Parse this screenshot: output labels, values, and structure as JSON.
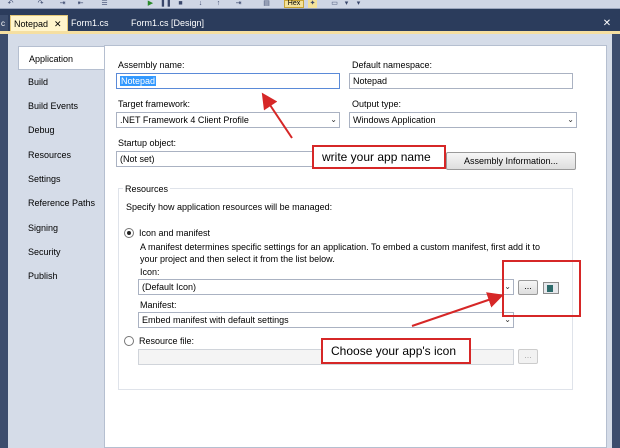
{
  "toolbar": {
    "hex_label": "Hex"
  },
  "tabs": [
    {
      "label": "Notepad",
      "close": "✕",
      "active": true
    },
    {
      "label": "Form1.cs",
      "active": false
    },
    {
      "label": "Form1.cs [Design]",
      "active": false
    }
  ],
  "window_close": "✕",
  "sidebar": {
    "items": [
      {
        "label": "Application"
      },
      {
        "label": "Build"
      },
      {
        "label": "Build Events"
      },
      {
        "label": "Debug"
      },
      {
        "label": "Resources"
      },
      {
        "label": "Settings"
      },
      {
        "label": "Reference Paths"
      },
      {
        "label": "Signing"
      },
      {
        "label": "Security"
      },
      {
        "label": "Publish"
      }
    ]
  },
  "form": {
    "assembly_name_label": "Assembly name:",
    "assembly_name_value": "Notepad",
    "default_namespace_label": "Default namespace:",
    "default_namespace_value": "Notepad",
    "target_framework_label": "Target framework:",
    "target_framework_value": ".NET Framework 4 Client Profile",
    "output_type_label": "Output type:",
    "output_type_value": "Windows Application",
    "startup_object_label": "Startup object:",
    "startup_object_value": "(Not set)",
    "assembly_info_button": "Assembly Information...",
    "resources_group_label": "Resources",
    "resources_desc": "Specify how application resources will be managed:",
    "icon_manifest_label": "Icon and manifest",
    "icon_manifest_desc_1": "A manifest determines specific settings for an application. To embed a custom manifest, first add it to",
    "icon_manifest_desc_2": "your project and then select it from the list below.",
    "icon_label": "Icon:",
    "icon_value": "(Default Icon)",
    "browse_button": "...",
    "manifest_label": "Manifest:",
    "manifest_value": "Embed manifest with default settings",
    "resource_file_label": "Resource file:",
    "resource_browse_button": "..."
  },
  "annotations": {
    "app_name_callout": "write your app name",
    "icon_callout": "Choose your app's icon"
  },
  "colors": {
    "accent_red": "#d62727",
    "tab_active": "#fff5cc",
    "panel_bg": "#d5dce8",
    "chrome_bg": "#2b3c5c"
  }
}
